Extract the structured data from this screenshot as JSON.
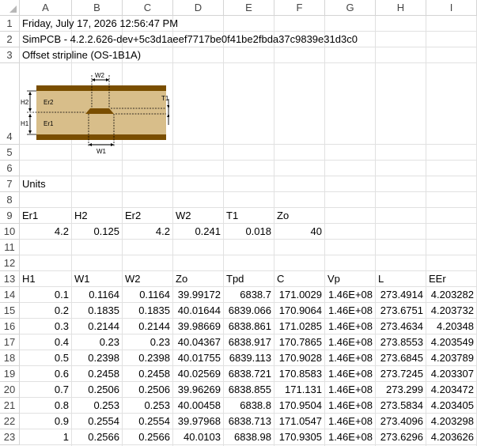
{
  "columns": [
    "A",
    "B",
    "C",
    "D",
    "E",
    "F",
    "G",
    "H",
    "I"
  ],
  "rows": [
    "1",
    "2",
    "3",
    "4",
    "5",
    "6",
    "7",
    "8",
    "9",
    "10",
    "11",
    "12",
    "13",
    "14",
    "15",
    "16",
    "17",
    "18",
    "19",
    "20",
    "21",
    "22",
    "23"
  ],
  "header_lines": {
    "r1": "Friday, July 17, 2026 12:56:47 PM",
    "r2": "SimPCB - 4.2.2.626-dev+5c3d1aeef7717be0f41be2fbda37c9839e31d3c0",
    "r3": "Offset stripline (OS-1B1A)",
    "r7": "Units"
  },
  "diagram": {
    "labels": {
      "w2": "W2",
      "w1": "W1",
      "h2": "H2",
      "h1": "H1",
      "er2": "Er2",
      "er1": "Er1",
      "t1": "T1"
    },
    "colors": {
      "copper": "#7a4e00",
      "dielectric": "#d8be8a",
      "dielectric_light": "#e6d2a6",
      "dim": "#000000"
    }
  },
  "params": {
    "headers": [
      "Er1",
      "H2",
      "Er2",
      "W2",
      "T1",
      "Zo"
    ],
    "values": [
      "4.2",
      "0.125",
      "4.2",
      "0.241",
      "0.018",
      "40"
    ]
  },
  "table": {
    "headers": [
      "H1",
      "W1",
      "W2",
      "Zo",
      "Tpd",
      "C",
      "Vp",
      "L",
      "EEr"
    ],
    "rows": [
      [
        "0.1",
        "0.1164",
        "0.1164",
        "39.99172",
        "6838.7",
        "171.0029",
        "1.46E+08",
        "273.4914",
        "4.203282"
      ],
      [
        "0.2",
        "0.1835",
        "0.1835",
        "40.01644",
        "6839.066",
        "170.9064",
        "1.46E+08",
        "273.6751",
        "4.203732"
      ],
      [
        "0.3",
        "0.2144",
        "0.2144",
        "39.98669",
        "6838.861",
        "171.0285",
        "1.46E+08",
        "273.4634",
        "4.20348"
      ],
      [
        "0.4",
        "0.23",
        "0.23",
        "40.04367",
        "6838.917",
        "170.7865",
        "1.46E+08",
        "273.8553",
        "4.203549"
      ],
      [
        "0.5",
        "0.2398",
        "0.2398",
        "40.01755",
        "6839.113",
        "170.9028",
        "1.46E+08",
        "273.6845",
        "4.203789"
      ],
      [
        "0.6",
        "0.2458",
        "0.2458",
        "40.02569",
        "6838.721",
        "170.8583",
        "1.46E+08",
        "273.7245",
        "4.203307"
      ],
      [
        "0.7",
        "0.2506",
        "0.2506",
        "39.96269",
        "6838.855",
        "171.131",
        "1.46E+08",
        "273.299",
        "4.203472"
      ],
      [
        "0.8",
        "0.253",
        "0.253",
        "40.00458",
        "6838.8",
        "170.9504",
        "1.46E+08",
        "273.5834",
        "4.203405"
      ],
      [
        "0.9",
        "0.2554",
        "0.2554",
        "39.97968",
        "6838.713",
        "171.0547",
        "1.46E+08",
        "273.4096",
        "4.203298"
      ],
      [
        "1",
        "0.2566",
        "0.2566",
        "40.0103",
        "6838.98",
        "170.9305",
        "1.46E+08",
        "273.6296",
        "4.203626"
      ]
    ]
  }
}
